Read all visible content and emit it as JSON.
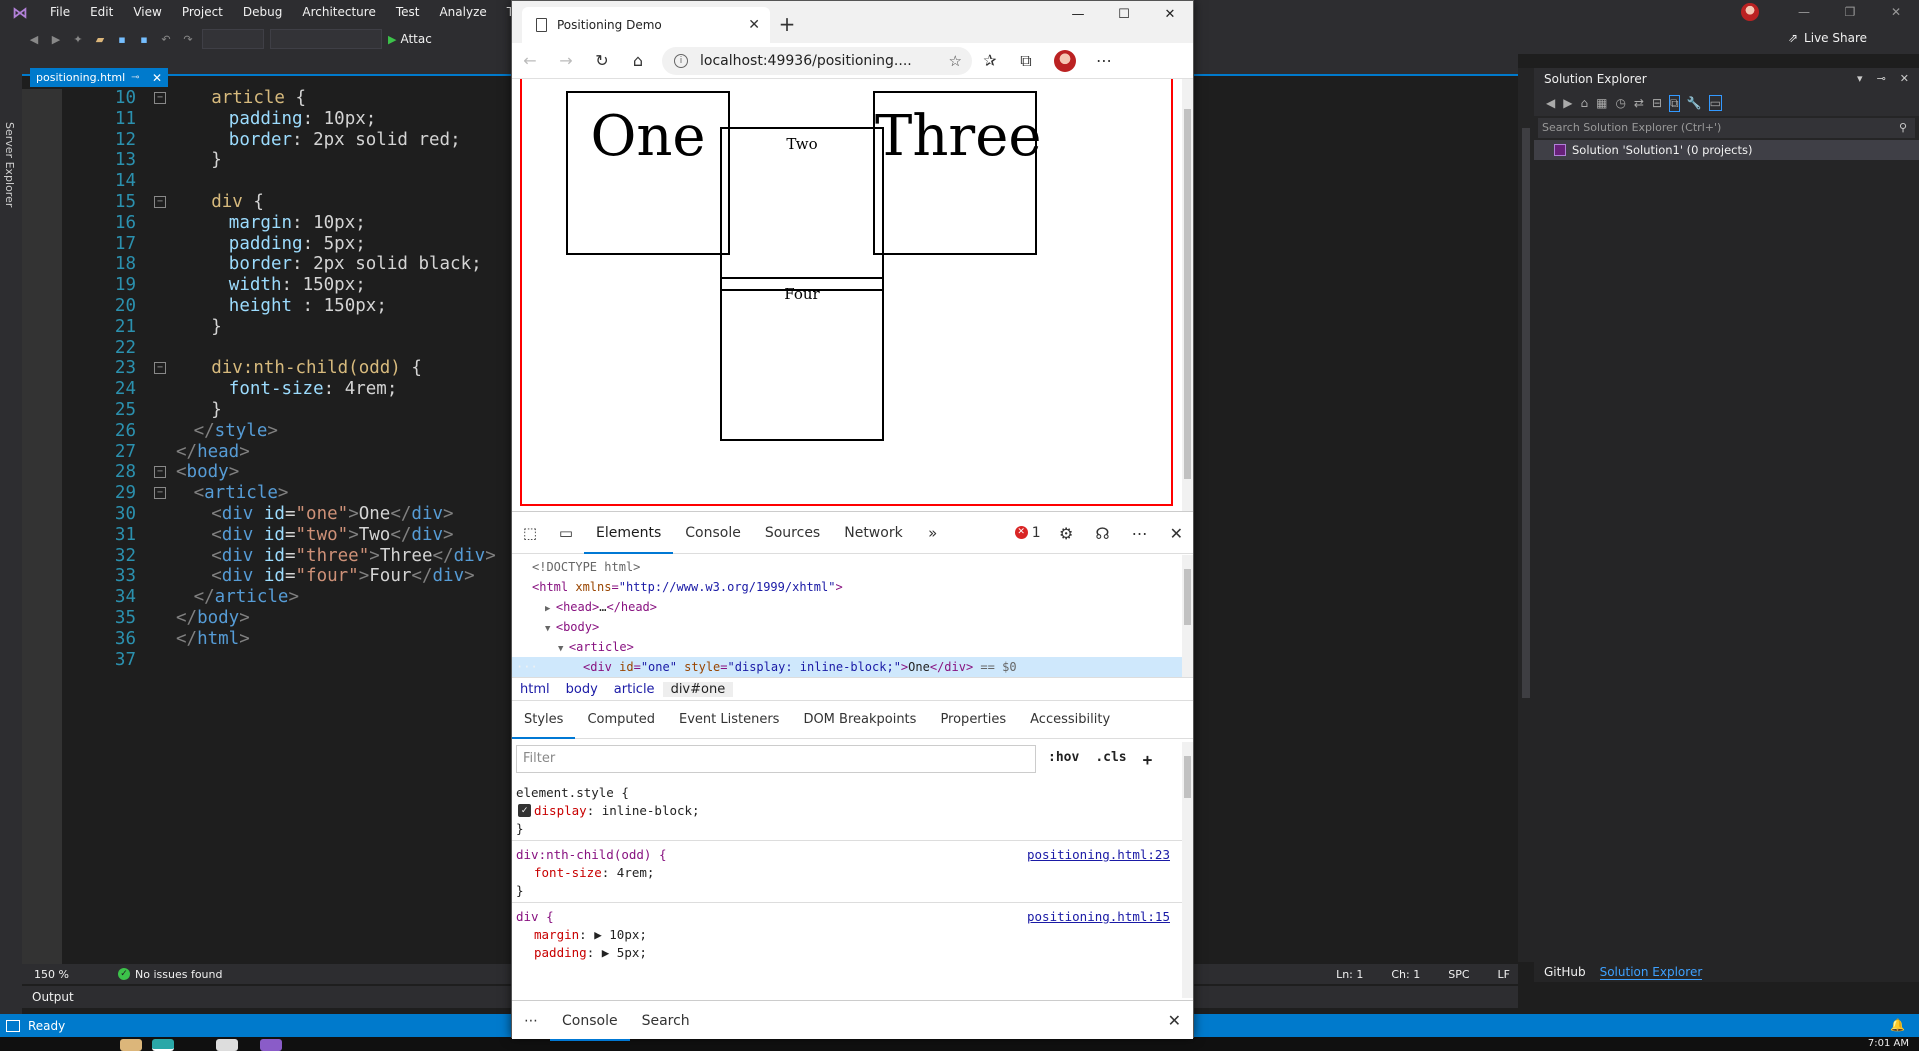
{
  "vs": {
    "menu": [
      "File",
      "Edit",
      "View",
      "Project",
      "Debug",
      "Architecture",
      "Test",
      "Analyze",
      "Tools"
    ],
    "attach_label": "Attac",
    "live_share_label": "Live Share",
    "server_explorer_label": "Server Explorer",
    "editor_tab_label": "positioning.html",
    "zoom_label": "150 %",
    "issues_label": "No issues found",
    "caret": {
      "line": "Ln: 1",
      "col": "Ch: 1",
      "spc": "SPC",
      "eol": "LF"
    },
    "output_label": "Output",
    "status_ready": "Ready",
    "clock": "7:01 AM",
    "accent_color": "#007acc"
  },
  "code_lines": [
    {
      "n": "10",
      "indent": 2,
      "fold": true,
      "tokens": [
        [
          "t-sel",
          "article"
        ],
        [
          "t-punc",
          " {"
        ]
      ]
    },
    {
      "n": "11",
      "indent": 3,
      "tokens": [
        [
          "t-prop",
          "padding"
        ],
        [
          "t-punc",
          ": "
        ],
        [
          "t-val",
          "10px"
        ],
        [
          "t-punc",
          ";"
        ]
      ]
    },
    {
      "n": "12",
      "indent": 3,
      "tokens": [
        [
          "t-prop",
          "border"
        ],
        [
          "t-punc",
          ": "
        ],
        [
          "t-val",
          "2px solid red"
        ],
        [
          "t-punc",
          ";"
        ]
      ]
    },
    {
      "n": "13",
      "indent": 2,
      "tokens": [
        [
          "t-punc",
          "}"
        ]
      ]
    },
    {
      "n": "14",
      "indent": 0,
      "tokens": []
    },
    {
      "n": "15",
      "indent": 2,
      "fold": true,
      "tokens": [
        [
          "t-sel",
          "div"
        ],
        [
          "t-punc",
          " {"
        ]
      ]
    },
    {
      "n": "16",
      "indent": 3,
      "tokens": [
        [
          "t-prop",
          "margin"
        ],
        [
          "t-punc",
          ": "
        ],
        [
          "t-val",
          "10px"
        ],
        [
          "t-punc",
          ";"
        ]
      ]
    },
    {
      "n": "17",
      "indent": 3,
      "tokens": [
        [
          "t-prop",
          "padding"
        ],
        [
          "t-punc",
          ": "
        ],
        [
          "t-val",
          "5px"
        ],
        [
          "t-punc",
          ";"
        ]
      ]
    },
    {
      "n": "18",
      "indent": 3,
      "tokens": [
        [
          "t-prop",
          "border"
        ],
        [
          "t-punc",
          ": "
        ],
        [
          "t-val",
          "2px solid black"
        ],
        [
          "t-punc",
          ";"
        ]
      ]
    },
    {
      "n": "19",
      "indent": 3,
      "tokens": [
        [
          "t-prop",
          "width"
        ],
        [
          "t-punc",
          ": "
        ],
        [
          "t-val",
          "150px"
        ],
        [
          "t-punc",
          ";"
        ]
      ]
    },
    {
      "n": "20",
      "indent": 3,
      "tokens": [
        [
          "t-prop",
          "height"
        ],
        [
          "t-punc",
          " : "
        ],
        [
          "t-val",
          "150px"
        ],
        [
          "t-punc",
          ";"
        ]
      ]
    },
    {
      "n": "21",
      "indent": 2,
      "tokens": [
        [
          "t-punc",
          "}"
        ]
      ]
    },
    {
      "n": "22",
      "indent": 0,
      "tokens": []
    },
    {
      "n": "23",
      "indent": 2,
      "fold": true,
      "tokens": [
        [
          "t-sel",
          "div:nth-child(odd)"
        ],
        [
          "t-punc",
          " {"
        ]
      ]
    },
    {
      "n": "24",
      "indent": 3,
      "tokens": [
        [
          "t-prop",
          "font-size"
        ],
        [
          "t-punc",
          ": "
        ],
        [
          "t-val",
          "4rem"
        ],
        [
          "t-punc",
          ";"
        ]
      ]
    },
    {
      "n": "25",
      "indent": 2,
      "tokens": [
        [
          "t-punc",
          "}"
        ]
      ]
    },
    {
      "n": "26",
      "indent": 1,
      "tokens": [
        [
          "t-bracket",
          "</"
        ],
        [
          "t-elem",
          "style"
        ],
        [
          "t-bracket",
          ">"
        ]
      ]
    },
    {
      "n": "27",
      "indent": 0,
      "tokens": [
        [
          "t-bracket",
          "</"
        ],
        [
          "t-elem",
          "head"
        ],
        [
          "t-bracket",
          ">"
        ]
      ]
    },
    {
      "n": "28",
      "indent": 0,
      "fold": true,
      "tokens": [
        [
          "t-bracket",
          "<"
        ],
        [
          "t-elem",
          "body"
        ],
        [
          "t-bracket",
          ">"
        ]
      ]
    },
    {
      "n": "29",
      "indent": 1,
      "fold": true,
      "tokens": [
        [
          "t-bracket",
          "<"
        ],
        [
          "t-elem",
          "article"
        ],
        [
          "t-bracket",
          ">"
        ]
      ]
    },
    {
      "n": "30",
      "indent": 2,
      "tokens": [
        [
          "t-bracket",
          "<"
        ],
        [
          "t-elem",
          "div"
        ],
        [
          "t-attr",
          " id"
        ],
        [
          "t-punc",
          "="
        ],
        [
          "t-str",
          "\"one\""
        ],
        [
          "t-bracket",
          ">"
        ],
        [
          "t-text",
          "One"
        ],
        [
          "t-bracket",
          "</"
        ],
        [
          "t-elem",
          "div"
        ],
        [
          "t-bracket",
          ">"
        ]
      ]
    },
    {
      "n": "31",
      "indent": 2,
      "tokens": [
        [
          "t-bracket",
          "<"
        ],
        [
          "t-elem",
          "div"
        ],
        [
          "t-attr",
          " id"
        ],
        [
          "t-punc",
          "="
        ],
        [
          "t-str",
          "\"two\""
        ],
        [
          "t-bracket",
          ">"
        ],
        [
          "t-text",
          "Two"
        ],
        [
          "t-bracket",
          "</"
        ],
        [
          "t-elem",
          "div"
        ],
        [
          "t-bracket",
          ">"
        ]
      ]
    },
    {
      "n": "32",
      "indent": 2,
      "tokens": [
        [
          "t-bracket",
          "<"
        ],
        [
          "t-elem",
          "div"
        ],
        [
          "t-attr",
          " id"
        ],
        [
          "t-punc",
          "="
        ],
        [
          "t-str",
          "\"three\""
        ],
        [
          "t-bracket",
          ">"
        ],
        [
          "t-text",
          "Three"
        ],
        [
          "t-bracket",
          "</"
        ],
        [
          "t-elem",
          "div"
        ],
        [
          "t-bracket",
          ">"
        ]
      ]
    },
    {
      "n": "33",
      "indent": 2,
      "tokens": [
        [
          "t-bracket",
          "<"
        ],
        [
          "t-elem",
          "div"
        ],
        [
          "t-attr",
          " id"
        ],
        [
          "t-punc",
          "="
        ],
        [
          "t-str",
          "\"four\""
        ],
        [
          "t-bracket",
          ">"
        ],
        [
          "t-text",
          "Four"
        ],
        [
          "t-bracket",
          "</"
        ],
        [
          "t-elem",
          "div"
        ],
        [
          "t-bracket",
          ">"
        ]
      ]
    },
    {
      "n": "34",
      "indent": 1,
      "tokens": [
        [
          "t-bracket",
          "</"
        ],
        [
          "t-elem",
          "article"
        ],
        [
          "t-bracket",
          ">"
        ]
      ]
    },
    {
      "n": "35",
      "indent": 0,
      "tokens": [
        [
          "t-bracket",
          "</"
        ],
        [
          "t-elem",
          "body"
        ],
        [
          "t-bracket",
          ">"
        ]
      ]
    },
    {
      "n": "36",
      "indent": 0,
      "tokens": [
        [
          "t-bracket",
          "</"
        ],
        [
          "t-elem",
          "html"
        ],
        [
          "t-bracket",
          ">"
        ]
      ]
    },
    {
      "n": "37",
      "indent": 0,
      "tokens": []
    }
  ],
  "solution": {
    "title": "Solution Explorer",
    "search_placeholder": "Search Solution Explorer (Ctrl+')",
    "item": "Solution 'Solution1' (0 projects)",
    "tabs": [
      "GitHub",
      "Solution Explorer"
    ]
  },
  "browser": {
    "tab_title": "Positioning Demo",
    "url": "localhost:49936/positioning....",
    "page": {
      "divs": [
        {
          "id": "one",
          "text": "One"
        },
        {
          "id": "two",
          "text": "Two"
        },
        {
          "id": "three",
          "text": "Three"
        },
        {
          "id": "four",
          "text": "Four"
        }
      ]
    }
  },
  "devtools": {
    "tabs": [
      "Elements",
      "Console",
      "Sources",
      "Network"
    ],
    "error_count": "1",
    "dom": [
      {
        "indent": 0,
        "html": "<!DOCTYPE html>",
        "kind": "gray"
      },
      {
        "indent": 0,
        "kind": "tag",
        "parts": [
          [
            "d-tag",
            "<html "
          ],
          [
            "d-attr",
            "xmlns"
          ],
          [
            "d-tag",
            "="
          ],
          [
            "d-val",
            "\"http://www.w3.org/1999/xhtml\""
          ],
          [
            "d-tag",
            ">"
          ]
        ]
      },
      {
        "indent": 1,
        "arrow": "▶",
        "kind": "tag",
        "parts": [
          [
            "d-tag",
            "<head>"
          ],
          [
            "d-txt",
            "…"
          ],
          [
            "d-tag",
            "</head>"
          ]
        ]
      },
      {
        "indent": 1,
        "arrow": "▼",
        "kind": "tag",
        "parts": [
          [
            "d-tag",
            "<body>"
          ]
        ]
      },
      {
        "indent": 2,
        "arrow": "▼",
        "kind": "tag",
        "parts": [
          [
            "d-tag",
            "<article>"
          ]
        ]
      },
      {
        "indent": 3,
        "sel": true,
        "kind": "tag",
        "parts": [
          [
            "d-tag",
            "<div "
          ],
          [
            "d-attr",
            "id"
          ],
          [
            "d-tag",
            "="
          ],
          [
            "d-val",
            "\"one\""
          ],
          [
            "d-attr",
            " style"
          ],
          [
            "d-tag",
            "="
          ],
          [
            "d-val",
            "\"display: inline-block;\""
          ],
          [
            "d-tag",
            ">"
          ],
          [
            "d-txt",
            "One"
          ],
          [
            "d-tag",
            "</div>"
          ],
          [
            "d-gray",
            " == $0"
          ]
        ]
      },
      {
        "indent": 3,
        "kind": "tag",
        "parts": [
          [
            "d-tag",
            "<div "
          ],
          [
            "d-attr",
            "id"
          ],
          [
            "d-tag",
            "="
          ],
          [
            "d-val",
            "\"two\""
          ],
          [
            "d-attr",
            " style"
          ],
          [
            "d-tag",
            "="
          ],
          [
            "d-val",
            "\"display: inline-block;\""
          ],
          [
            "d-tag",
            ">"
          ],
          [
            "d-txt",
            "Two"
          ],
          [
            "d-tag",
            "</div>"
          ]
        ]
      }
    ],
    "crumbs": [
      "html",
      "body",
      "article",
      "div#one"
    ],
    "subtabs": [
      "Styles",
      "Computed",
      "Event Listeners",
      "DOM Breakpoints",
      "Properties",
      "Accessibility"
    ],
    "filter_placeholder": "Filter",
    "hov": ":hov",
    "cls": ".cls",
    "styles": {
      "element_style": "element.style {",
      "rule1_prop": "display",
      "rule1_val": "inline-block;",
      "nth_selector": "div:nth-child(odd) {",
      "nth_link": "positioning.html:23",
      "nth_prop": "font-size",
      "nth_val": "4rem;",
      "div_selector": "div {",
      "div_link": "positioning.html:15",
      "div_margin_prop": "margin",
      "div_margin_val": "10px;",
      "div_padding_prop": "padding",
      "div_padding_val": "5px;"
    },
    "drawer_tabs": [
      "Console",
      "Search"
    ]
  }
}
